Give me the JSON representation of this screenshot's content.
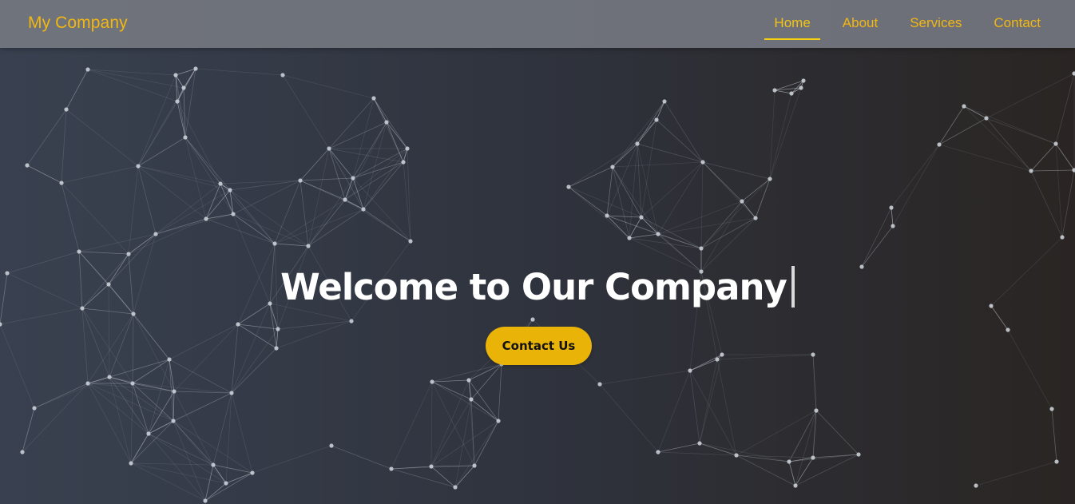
{
  "header": {
    "brand": "My Company",
    "nav": [
      {
        "label": "Home",
        "active": true
      },
      {
        "label": "About",
        "active": false
      },
      {
        "label": "Services",
        "active": false
      },
      {
        "label": "Contact",
        "active": false
      }
    ]
  },
  "hero": {
    "title": "Welcome to Our Company",
    "cta_label": "Contact Us"
  },
  "colors": {
    "accent": "#eab308",
    "nav_text": "#f2b711",
    "background_left": "#394150",
    "background_right": "#2a2523",
    "network_line": "#cfd4dc"
  }
}
